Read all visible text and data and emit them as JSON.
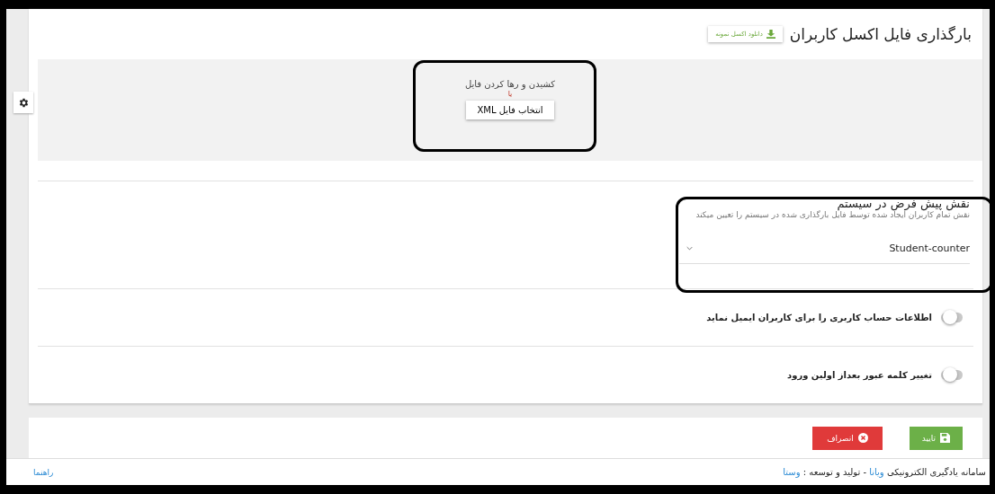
{
  "header": {
    "title": "بارگذاری فایل اکسل کاربران",
    "download_button": "دانلود اکسل نمونه"
  },
  "dropzone": {
    "prompt": "کشیدن و رها کردن فایل",
    "or": "یا",
    "button": "انتخاب فایل XML"
  },
  "role": {
    "title": "نقش پیش فرض در سیستم",
    "description": "نقش تمام کاربران ایجاد شده توسط فایل بارگذاری شده در سیستم را تعیین میکند",
    "value": "Student-counter"
  },
  "toggles": [
    {
      "label": "اطلاعات حساب کاربری را برای کاربران ایمیل نماید",
      "on": false
    },
    {
      "label": "تغییر کلمه عبور بعداز اولین ورود",
      "on": false
    }
  ],
  "actions": [
    {
      "label": "تایید",
      "kind": "confirm"
    },
    {
      "label": "انصراف",
      "kind": "cancel"
    }
  ],
  "footer": {
    "credits": [
      {
        "text": "سامانه یادگیری الکترونیکی ",
        "link": false
      },
      {
        "text": "ویانا",
        "link": true
      },
      {
        "text": " - تولید و توسعه : ",
        "link": false
      },
      {
        "text": "وستا",
        "link": true
      }
    ],
    "help": "راهنما"
  }
}
